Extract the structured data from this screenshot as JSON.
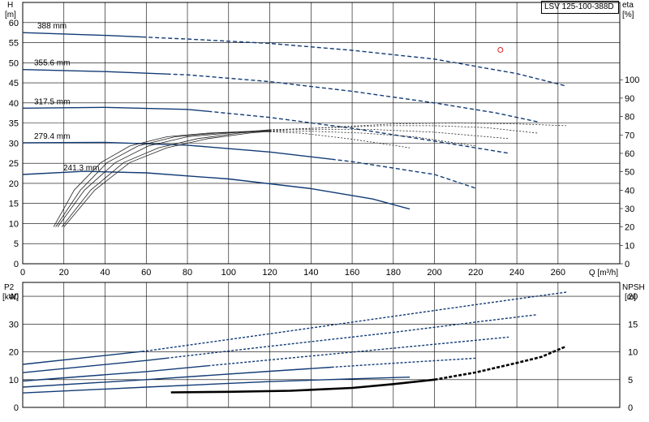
{
  "header": {
    "model": "LSV 125-100-388D"
  },
  "chart_data": [
    {
      "type": "line",
      "name": "head_efficiency",
      "x_axis": {
        "label": "Q [m³/h]",
        "ticks": [
          0,
          20,
          40,
          60,
          80,
          100,
          120,
          140,
          160,
          180,
          200,
          220,
          240,
          260
        ],
        "range": [
          0,
          290
        ]
      },
      "y_axis_left": {
        "label_top": "H",
        "label_unit": "[m]",
        "ticks": [
          0,
          5,
          10,
          15,
          20,
          25,
          30,
          35,
          40,
          45,
          50,
          55,
          60
        ],
        "range": [
          0,
          65
        ]
      },
      "y_axis_right": {
        "label_top": "eta",
        "label_unit": "[%]",
        "ticks": [
          0,
          10,
          20,
          30,
          40,
          50,
          60,
          70,
          80,
          90,
          100
        ],
        "range": [
          0,
          142
        ]
      },
      "operating_point": {
        "q": 232,
        "h": 53.2,
        "color": "#e02020"
      },
      "head_series": [
        {
          "name": "388 mm",
          "solid_until": 58,
          "points": [
            [
              0,
              57.5
            ],
            [
              40,
              56.8
            ],
            [
              80,
              55.9
            ],
            [
              120,
              54.8
            ],
            [
              160,
              53.1
            ],
            [
              200,
              50.9
            ],
            [
              240,
              47.3
            ],
            [
              264,
              44.2
            ]
          ]
        },
        {
          "name": "355.6 mm",
          "solid_until": 70,
          "points": [
            [
              0,
              48.3
            ],
            [
              40,
              47.8
            ],
            [
              80,
              47.0
            ],
            [
              120,
              45.3
            ],
            [
              160,
              42.9
            ],
            [
              200,
              40.0
            ],
            [
              230,
              37.5
            ],
            [
              250,
              35.3
            ]
          ]
        },
        {
          "name": "317.5 mm",
          "solid_until": 90,
          "points": [
            [
              0,
              38.7
            ],
            [
              40,
              38.9
            ],
            [
              80,
              38.4
            ],
            [
              120,
              36.4
            ],
            [
              160,
              33.7
            ],
            [
              200,
              30.5
            ],
            [
              236,
              27.5
            ]
          ]
        },
        {
          "name": "279.4 mm",
          "solid_until": 150,
          "points": [
            [
              0,
              30.1
            ],
            [
              40,
              30.2
            ],
            [
              80,
              29.5
            ],
            [
              120,
              27.8
            ],
            [
              160,
              25.4
            ],
            [
              200,
              22.2
            ],
            [
              220,
              18.8
            ]
          ]
        },
        {
          "name": "241.3 mm",
          "solid_until": 188,
          "points": [
            [
              0,
              22.2
            ],
            [
              30,
              23.0
            ],
            [
              60,
              22.6
            ],
            [
              100,
              21.1
            ],
            [
              140,
              18.7
            ],
            [
              170,
              16.1
            ],
            [
              188,
              13.6
            ]
          ]
        }
      ],
      "efficiency_series": [
        {
          "name": "eta_388",
          "solid_until": 120,
          "points": [
            [
              20,
              20
            ],
            [
              35,
              40
            ],
            [
              52,
              55
            ],
            [
              70,
              63
            ],
            [
              90,
              68
            ],
            [
              110,
              71
            ],
            [
              130,
              73
            ],
            [
              155,
              74.5
            ],
            [
              180,
              76
            ],
            [
              210,
              76.5
            ],
            [
              240,
              76
            ],
            [
              264,
              75
            ]
          ]
        },
        {
          "name": "eta_355.6",
          "solid_until": 120,
          "points": [
            [
              19,
              20
            ],
            [
              33,
              40
            ],
            [
              49,
              55
            ],
            [
              66,
              63
            ],
            [
              85,
              68
            ],
            [
              105,
              71
            ],
            [
              125,
              73
            ],
            [
              150,
              74
            ],
            [
              175,
              75
            ],
            [
              200,
              75
            ],
            [
              225,
              74
            ],
            [
              250,
              71
            ]
          ]
        },
        {
          "name": "eta_317.5",
          "solid_until": 120,
          "points": [
            [
              17,
              20
            ],
            [
              30,
              40
            ],
            [
              45,
              55
            ],
            [
              61,
              64
            ],
            [
              80,
              69
            ],
            [
              100,
              71
            ],
            [
              122,
              73
            ],
            [
              145,
              73
            ],
            [
              170,
              73
            ],
            [
              200,
              71.5
            ],
            [
              236,
              68
            ]
          ]
        },
        {
          "name": "eta_279.4",
          "solid_until": 120,
          "points": [
            [
              16,
              20
            ],
            [
              28,
              40
            ],
            [
              41,
              55
            ],
            [
              56,
              64
            ],
            [
              74,
              69
            ],
            [
              94,
              71
            ],
            [
              118,
              72
            ],
            [
              140,
              72
            ],
            [
              165,
              71
            ],
            [
              190,
              69
            ],
            [
              220,
              64
            ]
          ]
        },
        {
          "name": "eta_241.3",
          "solid_until": 120,
          "points": [
            [
              15,
              20
            ],
            [
              25,
              40
            ],
            [
              38,
              55
            ],
            [
              52,
              64
            ],
            [
              70,
              69
            ],
            [
              90,
              71
            ],
            [
              112,
              72
            ],
            [
              135,
              71
            ],
            [
              158,
              68
            ],
            [
              188,
              63
            ]
          ]
        }
      ]
    },
    {
      "type": "line",
      "name": "power_npsh",
      "x_axis": {
        "range": [
          0,
          290
        ],
        "ticks": [
          0,
          20,
          40,
          60,
          80,
          100,
          120,
          140,
          160,
          180,
          200,
          220,
          240,
          260
        ]
      },
      "y_axis_left": {
        "label_top": "P2",
        "label_unit": "[kW]",
        "ticks": [
          0,
          10,
          20,
          30,
          40
        ],
        "range": [
          0,
          45
        ]
      },
      "y_axis_right": {
        "label_top": "NPSH",
        "label_unit": "[m]",
        "ticks": [
          0,
          5,
          10,
          15,
          20
        ],
        "range": [
          0,
          22.5
        ]
      },
      "power_series": [
        {
          "name": "P2_388",
          "solid_until": 58,
          "points": [
            [
              0,
              15.5
            ],
            [
              60,
              20.3
            ],
            [
              120,
              26.5
            ],
            [
              180,
              32.8
            ],
            [
              220,
              37.0
            ],
            [
              264,
              41.5
            ]
          ]
        },
        {
          "name": "P2_355.6",
          "solid_until": 70,
          "points": [
            [
              0,
              12.5
            ],
            [
              60,
              16.9
            ],
            [
              120,
              22.0
            ],
            [
              180,
              27.0
            ],
            [
              220,
              30.7
            ],
            [
              250,
              33.4
            ]
          ]
        },
        {
          "name": "P2_317.5",
          "solid_until": 90,
          "points": [
            [
              0,
              9.5
            ],
            [
              60,
              12.9
            ],
            [
              120,
              17.1
            ],
            [
              180,
              21.3
            ],
            [
              236,
              25.3
            ]
          ]
        },
        {
          "name": "P2_279.4",
          "solid_until": 150,
          "points": [
            [
              0,
              7.3
            ],
            [
              60,
              10.0
            ],
            [
              120,
              13.0
            ],
            [
              180,
              15.9
            ],
            [
              220,
              17.7
            ]
          ]
        },
        {
          "name": "P2_241.3",
          "solid_until": 188,
          "points": [
            [
              0,
              5.2
            ],
            [
              60,
              7.3
            ],
            [
              120,
              9.3
            ],
            [
              160,
              10.3
            ],
            [
              188,
              10.9
            ]
          ]
        }
      ],
      "npsh_series": [
        {
          "name": "NPSH",
          "solid_until": 200,
          "points": [
            [
              72,
              2.7
            ],
            [
              100,
              2.8
            ],
            [
              130,
              3.0
            ],
            [
              160,
              3.5
            ],
            [
              180,
              4.2
            ],
            [
              200,
              5.0
            ],
            [
              220,
              6.3
            ],
            [
              240,
              8.0
            ],
            [
              252,
              9.1
            ],
            [
              264,
              11.0
            ]
          ]
        }
      ]
    }
  ]
}
